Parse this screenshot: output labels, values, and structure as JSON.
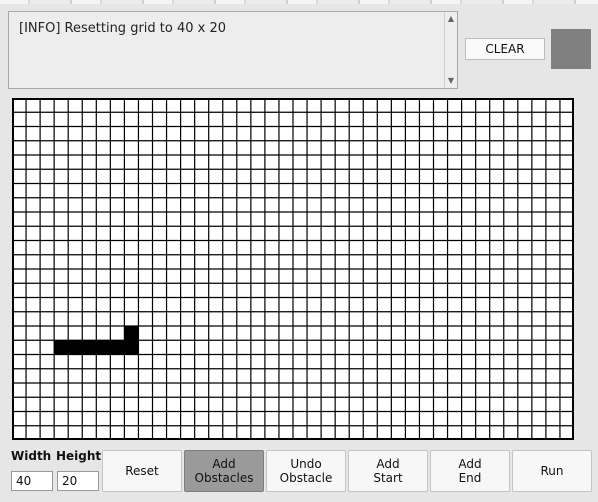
{
  "log": {
    "lines": [
      "[INFO] Resetting grid to 40 x 20"
    ]
  },
  "clear_button": {
    "label": "CLEAR"
  },
  "color_swatch": {
    "color": "#808080"
  },
  "grid": {
    "columns": 40,
    "rows": 24,
    "obstacles": [
      [
        8,
        16
      ],
      [
        8,
        17
      ],
      [
        3,
        17
      ],
      [
        4,
        17
      ],
      [
        5,
        17
      ],
      [
        6,
        17
      ],
      [
        7,
        17
      ]
    ]
  },
  "controls": {
    "width_label": "Width",
    "height_label": "Height",
    "width_value": "40",
    "height_value": "20",
    "reset_label": "Reset",
    "add_obstacles_label": "Add\nObstacles",
    "undo_obstacle_label": "Undo\nObstacle",
    "add_start_label": "Add\nStart",
    "add_end_label": "Add\nEnd",
    "run_label": "Run"
  }
}
